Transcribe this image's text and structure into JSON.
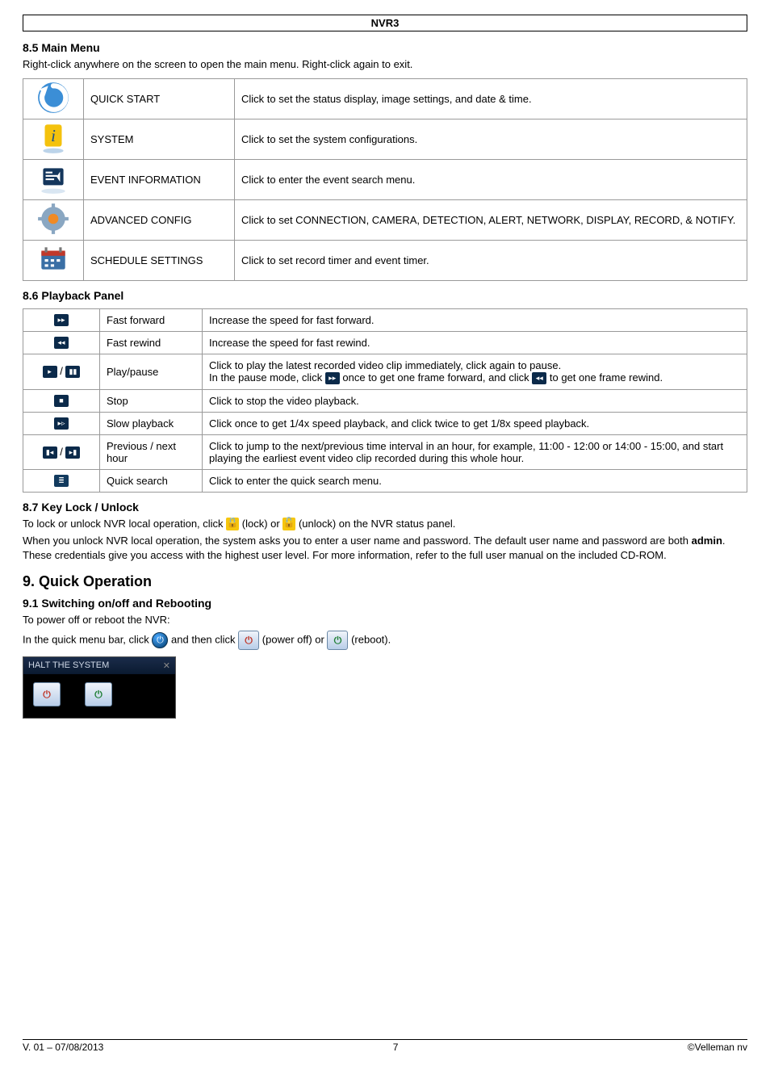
{
  "header": {
    "title": "NVR3"
  },
  "sec85": {
    "heading": "8.5   Main Menu",
    "intro": "Right-click anywhere on the screen to open the main menu. Right-click again to exit.",
    "rows": [
      {
        "label": "QUICK START",
        "desc": "Click to set the status display, image settings, and date & time."
      },
      {
        "label": "SYSTEM",
        "desc": "Click to set the system configurations."
      },
      {
        "label": "EVENT INFORMATION",
        "desc": "Click to enter the event search menu."
      },
      {
        "label": "ADVANCED CONFIG",
        "desc": "Click to set CONNECTION, CAMERA, DETECTION, ALERT, NETWORK, DISPLAY, RECORD, & NOTIFY."
      },
      {
        "label": "SCHEDULE SETTINGS",
        "desc": "Click to set record timer and event timer."
      }
    ]
  },
  "sec86": {
    "heading": "8.6   Playback Panel",
    "rows": [
      {
        "label": "Fast forward",
        "desc": "Increase the speed for fast forward."
      },
      {
        "label": "Fast rewind",
        "desc": "Increase the speed for fast rewind."
      },
      {
        "label": "Play/pause",
        "desc_a": "Click to play the latest recorded video clip immediately, click again to pause.",
        "desc_b1": "In the pause mode, click ",
        "desc_b2": " once to get one frame forward, and click ",
        "desc_b3": " to get one frame rewind."
      },
      {
        "label": "Stop",
        "desc": "Click to stop the video playback."
      },
      {
        "label": "Slow playback",
        "desc": "Click once to get 1/4x speed playback, and click twice to get 1/8x speed playback."
      },
      {
        "label": "Previous / next hour",
        "desc": "Click to jump to the next/previous time interval in an hour, for example, 11:00 - 12:00 or 14:00 - 15:00, and start playing the earliest event video clip recorded during this whole hour."
      },
      {
        "label": "Quick search",
        "desc": "Click to enter the quick search menu."
      }
    ]
  },
  "sec87": {
    "heading": "8.7   Key Lock / Unlock",
    "p1a": "To lock or unlock NVR local operation, click ",
    "p1b": " (lock) or ",
    "p1c": " (unlock) on the NVR status panel.",
    "p2": "When you unlock NVR local operation, the system asks you to enter a user name and password. The default user name and password are both ",
    "p2b": "admin",
    "p2c": ". These credentials give you access with the highest user level. For more information, refer to the full user manual on the included CD-ROM."
  },
  "sec9": {
    "heading": "9.    Quick Operation"
  },
  "sec91": {
    "heading": "9.1   Switching on/off and Rebooting",
    "p1": "To power off or reboot the NVR:",
    "p2a": "In the quick menu bar, click ",
    "p2b": " and then click ",
    "p2c": " (power off) or ",
    "p2d": " (reboot)."
  },
  "halt": {
    "title": "HALT THE SYSTEM"
  },
  "footer": {
    "left": "V. 01 – 07/08/2013",
    "center": "7",
    "right": "©Velleman nv"
  }
}
